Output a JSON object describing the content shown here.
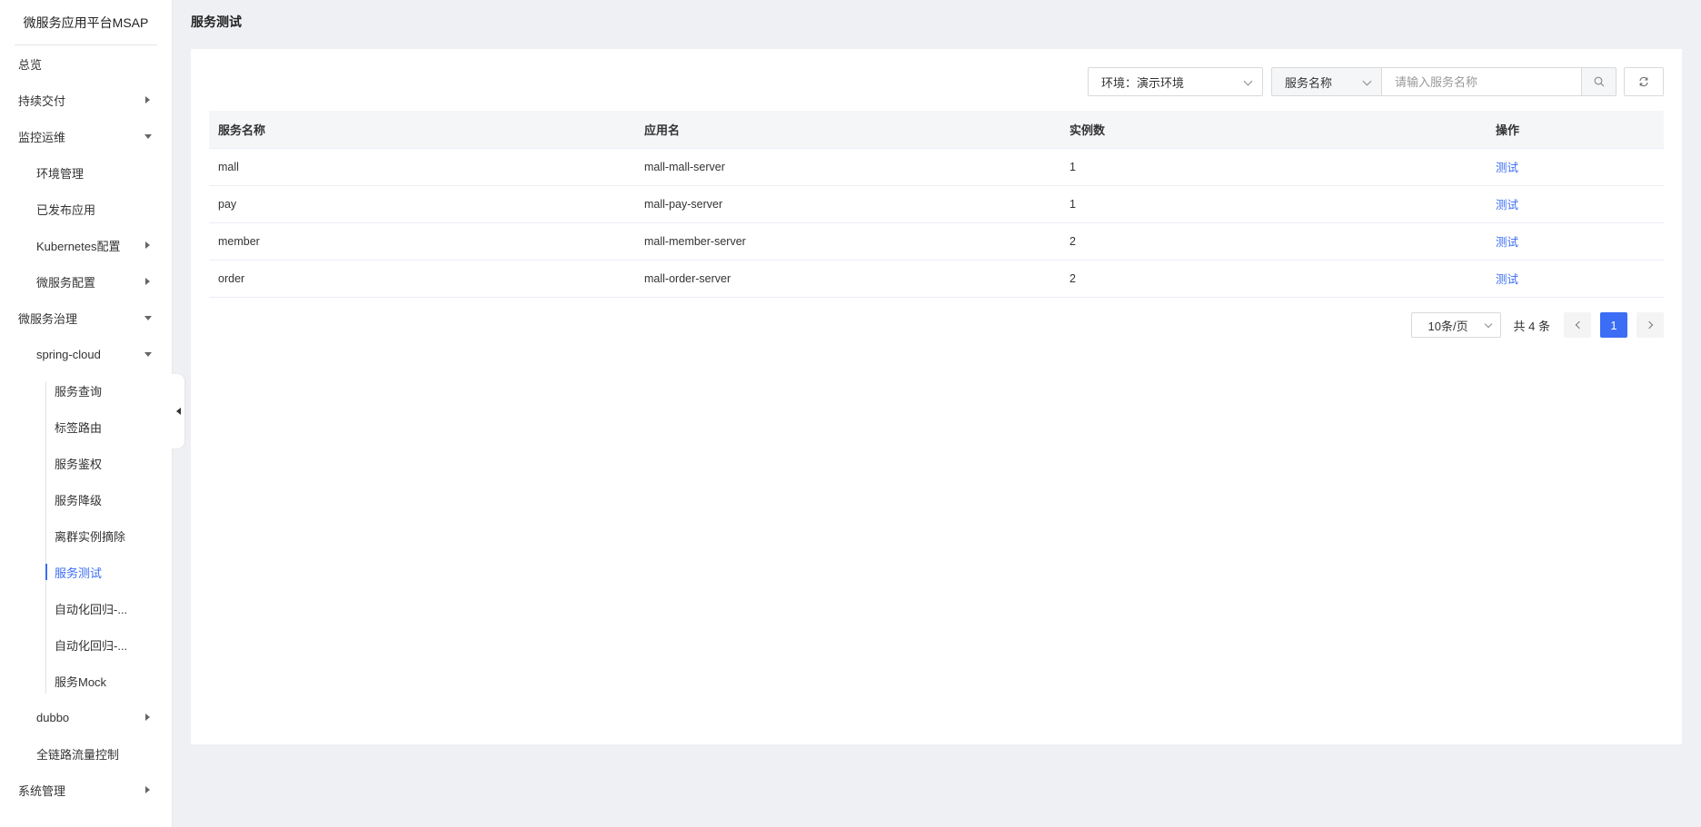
{
  "app": {
    "title": "微服务应用平台MSAP"
  },
  "sidebar": {
    "items": [
      {
        "label": "总览",
        "level": 1,
        "caret": ""
      },
      {
        "label": "持续交付",
        "level": 1,
        "caret": "right"
      },
      {
        "label": "监控运维",
        "level": 1,
        "caret": "down"
      },
      {
        "label": "环境管理",
        "level": 2,
        "caret": ""
      },
      {
        "label": "已发布应用",
        "level": 2,
        "caret": ""
      },
      {
        "label": "Kubernetes配置",
        "level": 2,
        "caret": "right"
      },
      {
        "label": "微服务配置",
        "level": 2,
        "caret": "right"
      },
      {
        "label": "微服务治理",
        "level": 1,
        "caret": "down"
      },
      {
        "label": "spring-cloud",
        "level": 2,
        "caret": "down"
      },
      {
        "label": "服务查询",
        "level": 3,
        "caret": ""
      },
      {
        "label": "标签路由",
        "level": 3,
        "caret": ""
      },
      {
        "label": "服务鉴权",
        "level": 3,
        "caret": ""
      },
      {
        "label": "服务降级",
        "level": 3,
        "caret": ""
      },
      {
        "label": "离群实例摘除",
        "level": 3,
        "caret": ""
      },
      {
        "label": "服务测试",
        "level": 3,
        "caret": "",
        "active": true
      },
      {
        "label": "自动化回归-...",
        "level": 3,
        "caret": ""
      },
      {
        "label": "自动化回归-...",
        "level": 3,
        "caret": ""
      },
      {
        "label": "服务Mock",
        "level": 3,
        "caret": ""
      },
      {
        "label": "dubbo",
        "level": 2,
        "caret": "right"
      },
      {
        "label": "全链路流量控制",
        "level": 2,
        "caret": ""
      },
      {
        "label": "系统管理",
        "level": 1,
        "caret": "right"
      }
    ]
  },
  "page": {
    "title": "服务测试"
  },
  "toolbar": {
    "env_select": "环境：演示环境",
    "field_select": "服务名称",
    "search_placeholder": "请输入服务名称"
  },
  "table": {
    "columns": [
      "服务名称",
      "应用名",
      "实例数",
      "操作"
    ],
    "rows": [
      {
        "name": "mall",
        "app": "mall-mall-server",
        "instances": "1",
        "action": "测试"
      },
      {
        "name": "pay",
        "app": "mall-pay-server",
        "instances": "1",
        "action": "测试"
      },
      {
        "name": "member",
        "app": "mall-member-server",
        "instances": "2",
        "action": "测试"
      },
      {
        "name": "order",
        "app": "mall-order-server",
        "instances": "2",
        "action": "测试"
      }
    ]
  },
  "pagination": {
    "page_size": "10条/页",
    "total": "共 4 条",
    "current": "1"
  },
  "colors": {
    "accent": "#3b6df5",
    "background": "#eef0f3"
  }
}
